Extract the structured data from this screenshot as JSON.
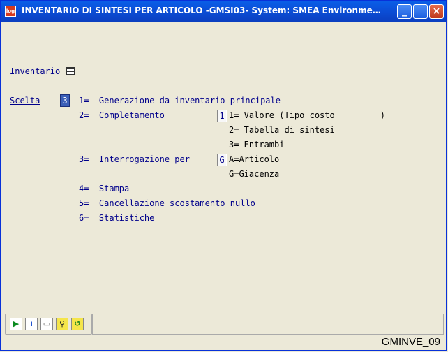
{
  "window": {
    "app_icon": "app-logo-icon",
    "title": "INVENTARIO DI SINTESI PER ARTICOLO -GMSI03- System: SMEA Environment: SVI Use...",
    "buttons": {
      "minimize": "minimize-icon",
      "maximize": "maximize-icon",
      "close": "close-icon"
    }
  },
  "form": {
    "inventario_label": "Inventario",
    "scelta_label": "Scelta",
    "scelta_value": "3",
    "options": [
      {
        "text": "1=  Generazione da inventario principale"
      },
      {
        "text": "2=  Completamento"
      },
      {
        "text": "3=  Interrogazione per"
      },
      {
        "text": "4=  Stampa"
      },
      {
        "text": "5=  Cancellazione scostamento nullo"
      },
      {
        "text": "6=  Statistiche"
      }
    ],
    "completamento": {
      "value": "1",
      "options": [
        "1= Valore (Tipo costo         )",
        "2= Tabella di sintesi",
        "3= Entrambi"
      ]
    },
    "interrogazione": {
      "value": "G",
      "options": [
        "A=Articolo",
        "G=Giacenza"
      ]
    }
  },
  "toolbar": {
    "icons": [
      "play-icon",
      "info-icon",
      "print-icon",
      "search-icon",
      "back-icon"
    ]
  },
  "status": {
    "code": "GMINVE_09"
  }
}
